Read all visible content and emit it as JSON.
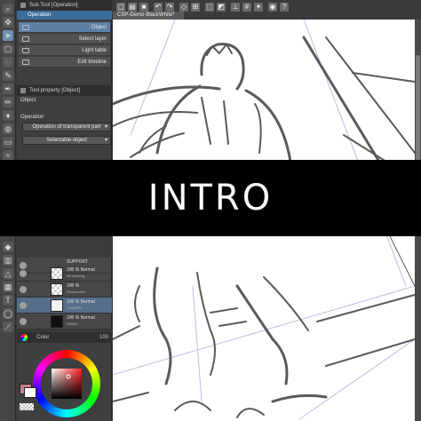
{
  "app": {
    "sub_tool_tab": "Sub Tool [Operation]",
    "sub_tool_group": "Operation",
    "sub_tools": [
      "Object",
      "Select layer",
      "Light table",
      "Edit timeline"
    ],
    "tool_property_tab": "Tool property [Object]",
    "tool_property_title": "Object",
    "operation_label": "Operation",
    "operation_option": "Operation of transparent part",
    "operation_target": "Selectable object",
    "document_tab": "CSP-Demo-BlackWhite*",
    "layers": [
      {
        "line1": "SUPPORT",
        "line2": ""
      },
      {
        "line1": "100 % Normal",
        "line2": "3D drawing"
      },
      {
        "line1": "100 %",
        "line2": "Perspective"
      },
      {
        "line1": "100 % Normal",
        "line2": "COLORS"
      },
      {
        "line1": "100 % Normal",
        "line2": "PANEL"
      }
    ],
    "color_tab": "Color",
    "zoom_value": "100",
    "accent": "#3a6c9c",
    "main_color": "#c97e8e"
  },
  "banner": {
    "text": "INTRO"
  }
}
